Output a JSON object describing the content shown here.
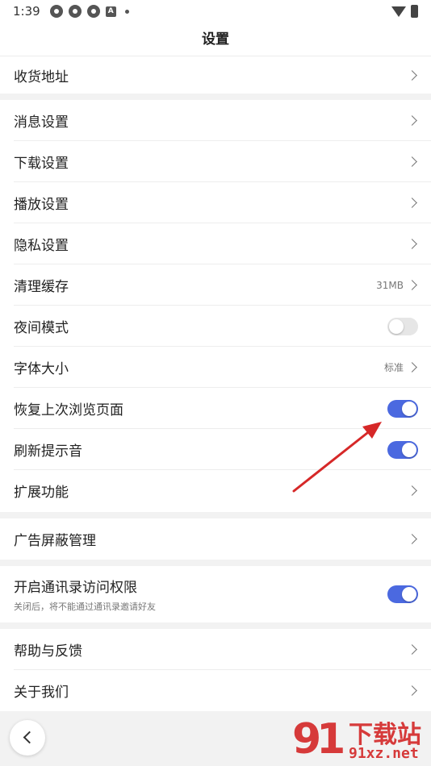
{
  "status_bar": {
    "time": "1:39",
    "notification_icons": [
      "app-icon",
      "app-icon",
      "app-icon",
      "a-icon",
      "dot-icon"
    ],
    "notification_letter": "A",
    "right_icons": [
      "wifi-icon",
      "battery-icon"
    ]
  },
  "header": {
    "title": "设置"
  },
  "groups": [
    {
      "rows": [
        {
          "label": "收货地址",
          "type": "link"
        }
      ]
    },
    {
      "rows": [
        {
          "label": "消息设置",
          "type": "link"
        },
        {
          "label": "下载设置",
          "type": "link"
        },
        {
          "label": "播放设置",
          "type": "link"
        },
        {
          "label": "隐私设置",
          "type": "link"
        },
        {
          "label": "清理缓存",
          "type": "link",
          "value": "31MB"
        },
        {
          "label": "夜间模式",
          "type": "toggle",
          "on": false
        },
        {
          "label": "字体大小",
          "type": "link",
          "value": "标准"
        },
        {
          "label": "恢复上次浏览页面",
          "type": "toggle",
          "on": true
        },
        {
          "label": "刷新提示音",
          "type": "toggle",
          "on": true
        },
        {
          "label": "扩展功能",
          "type": "link"
        }
      ]
    },
    {
      "rows": [
        {
          "label": "广告屏蔽管理",
          "type": "link"
        }
      ]
    },
    {
      "rows": [
        {
          "label": "开启通讯录访问权限",
          "type": "toggle",
          "on": true,
          "sub": "关闭后，将不能通过通讯录邀请好友"
        }
      ]
    },
    {
      "rows": [
        {
          "label": "帮助与反馈",
          "type": "link"
        },
        {
          "label": "关于我们",
          "type": "link"
        }
      ]
    }
  ],
  "watermark": {
    "logo": "91",
    "title": "下载站",
    "url": "91xz.net"
  },
  "colors": {
    "accent": "#4b69e0",
    "annotation_arrow": "#d62828",
    "watermark": "#d63a3a"
  }
}
